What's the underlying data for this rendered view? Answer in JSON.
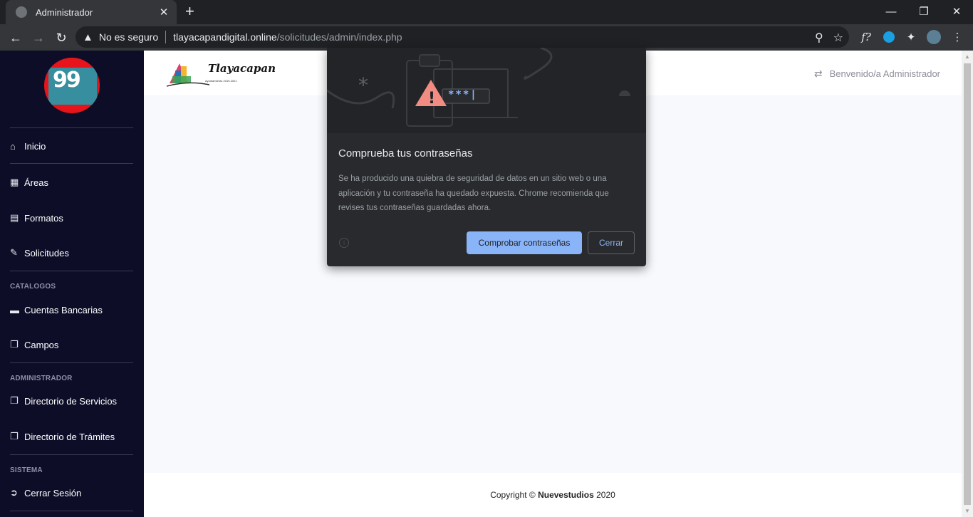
{
  "browser": {
    "tab_title": "Administrador",
    "tab_close": "✕",
    "new_tab": "+",
    "not_secure": "No es seguro",
    "url_host": "tlayacapandigital.online",
    "url_path": "/solicitudes/admin/index.php"
  },
  "sidebar": {
    "logo_text": "99",
    "items": [
      {
        "label": "Inicio",
        "icon": "home-icon"
      },
      {
        "label": "Áreas",
        "icon": "building-icon"
      },
      {
        "label": "Formatos",
        "icon": "document-icon"
      },
      {
        "label": "Solicitudes",
        "icon": "edit-icon"
      }
    ],
    "catalogos_header": "CATALOGOS",
    "catalogos_items": [
      {
        "label": "Cuentas Bancarias",
        "icon": "money-icon"
      },
      {
        "label": "Campos",
        "icon": "copy-icon"
      }
    ],
    "admin_header": "ADMINISTRADOR",
    "admin_items": [
      {
        "label": "Directorio de Servicios",
        "icon": "copy-icon"
      },
      {
        "label": "Directorio de Trámites",
        "icon": "copy-icon"
      }
    ],
    "sistema_header": "SISTEMA",
    "sistema_items": [
      {
        "label": "Cerrar Sesión",
        "icon": "sign-out-icon"
      }
    ]
  },
  "topbar": {
    "brand_text": "Tlayacapan",
    "brand_subtext": "Ayuntamiento 2019-2021",
    "welcome": "Benvenido/a Administrador"
  },
  "footer": {
    "prefix": "Copyright ©",
    "company": "Nuevestudios",
    "year": "2020"
  },
  "dialog": {
    "password_mask": "***|",
    "title": "Comprueba tus contraseñas",
    "body": "Se ha producido una quiebra de seguridad de datos en un sitio web o una aplicación y tu contraseña ha quedado expuesta. Chrome recomienda que revises tus contraseñas guardadas ahora.",
    "primary_button": "Comprobar contraseñas",
    "secondary_button": "Cerrar"
  },
  "colors": {
    "sidebar_bg": "#0d0d28",
    "accent_blue": "#8ab4f8",
    "warning_red": "#f28b82"
  }
}
